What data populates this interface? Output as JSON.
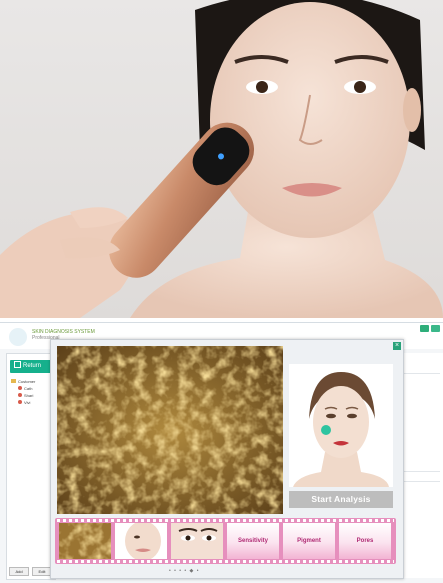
{
  "app": {
    "brand_line1": "SKIN DIAGNOSIS SYSTEM",
    "brand_line2": "Professional"
  },
  "sidebar": {
    "return_label": "Return",
    "tree": [
      {
        "label": "Customer",
        "level": 1
      },
      {
        "label": "Cath",
        "level": 2
      },
      {
        "label": "Shari",
        "level": 2
      },
      {
        "label": "Vivi",
        "level": 2
      }
    ],
    "add_label": "Add",
    "edit_label": "Edit"
  },
  "dialog": {
    "close_label": "×",
    "start_analysis_label": "Start Analysis",
    "thumbnails": [
      "skin-macro-thumb",
      "face-closeup-thumb",
      "eye-closeup-thumb"
    ],
    "modes": [
      "Sensitivity",
      "Pigment",
      "Pores"
    ],
    "pager": "• • • • ◆ •"
  },
  "colors": {
    "accent_green": "#16b08c",
    "film_pink": "#e68fbd",
    "mode_text": "#b02a74",
    "button_gray": "#bdbdbd"
  },
  "icons": [
    "logo-crescent-icon",
    "return-icon",
    "folder-icon",
    "user-icon",
    "close-icon"
  ]
}
